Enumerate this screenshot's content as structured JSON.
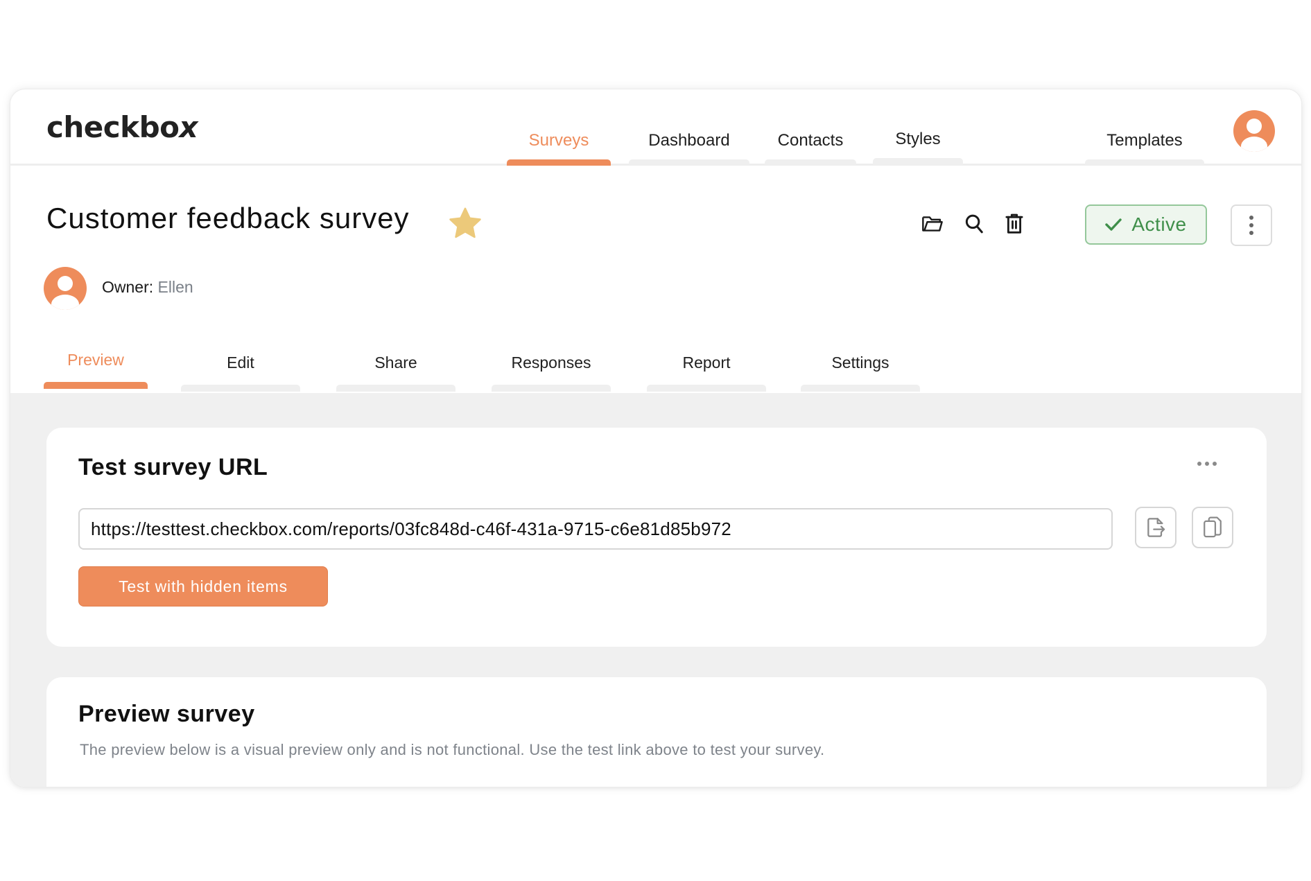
{
  "app": {
    "logo_text": "checkbo",
    "logo_x": "x"
  },
  "nav": {
    "tabs": [
      {
        "label": "Surveys",
        "active": true
      },
      {
        "label": "Dashboard",
        "active": false
      },
      {
        "label": "Contacts",
        "active": false
      },
      {
        "label": "Styles",
        "active": false
      },
      {
        "label": "Templates",
        "active": false
      }
    ],
    "user_avatar_icon": "user-avatar-icon"
  },
  "survey": {
    "title": "Customer feedback survey",
    "favorite_icon": "star-icon",
    "status": "Active",
    "owner_label": "Owner:",
    "owner_name": "Ellen",
    "toolbar_icons": [
      "folder-icon",
      "search-icon",
      "trash-icon"
    ]
  },
  "subtabs": [
    {
      "label": "Preview",
      "active": true
    },
    {
      "label": "Edit",
      "active": false
    },
    {
      "label": "Share",
      "active": false
    },
    {
      "label": "Responses",
      "active": false
    },
    {
      "label": "Report",
      "active": false
    },
    {
      "label": "Settings",
      "active": false
    }
  ],
  "test_url_card": {
    "title": "Test survey URL",
    "url": "https://testtest.checkbox.com/reports/03fc848d-c46f-431a-9715-c6e81d85b972",
    "button_label": "Test with hidden items",
    "action_icons": [
      "open-link-icon",
      "copy-icon"
    ]
  },
  "preview_card": {
    "title": "Preview survey",
    "description": "The preview below is a visual preview only and is not functional. Use the test link above to test your survey."
  },
  "colors": {
    "accent": "#ee8c5b",
    "status_green": "#3f8f4a",
    "status_bg": "#eef6ee",
    "star": "#ecc97a",
    "content_bg": "#f0f0f0"
  }
}
